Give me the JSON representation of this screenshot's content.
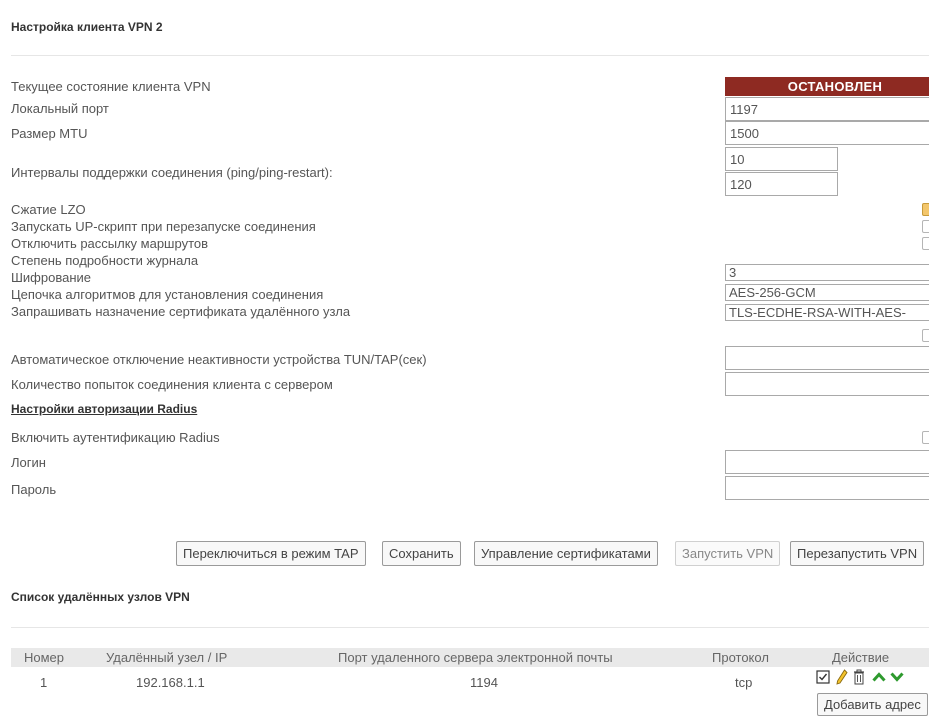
{
  "section1": {
    "title": "Настройка клиента VPN 2"
  },
  "fields": {
    "state_label": "Текущее состояние клиента VPN",
    "state_value": "ОСТАНОВЛЕН",
    "local_port_label": "Локальный порт",
    "local_port_value": "1197",
    "mtu_label": "Размер MTU",
    "mtu_value": "1500",
    "keepalive_label": "Интервалы поддержки соединения (ping/ping-restart):",
    "ping_value": "10",
    "ping_restart_value": "120",
    "lzo_label": "Сжатие LZO",
    "lzo_checked": true,
    "up_script_label": "Запускать UP-скрипт при перезапуске соединения",
    "no_routes_label": "Отключить рассылку маршрутов",
    "log_level_label": "Степень подробности журнала",
    "log_level_value": "3",
    "cipher_label": "Шифрование",
    "cipher_value": "AES-256-GCM",
    "tls_cipher_label": "Цепочка алгоритмов для установления соединения",
    "tls_cipher_value": "TLS-ECDHE-RSA-WITH-AES-",
    "remote_cert_label": "Запрашивать назначение сертификата удалённого узла",
    "inactive_label": "Автоматическое отключение неактивности устройства TUN/TAP(сек)",
    "inactive_value": "",
    "retry_label": "Количество попыток соединения клиента с сервером",
    "retry_value": ""
  },
  "radius": {
    "link": "Настройки авторизации Radius",
    "enable_label": "Включить аутентификацию Radius",
    "login_label": "Логин",
    "login_value": "",
    "password_label": "Пароль",
    "password_value": ""
  },
  "buttons": {
    "tap_mode": "Переключиться в режим TAP",
    "save": "Сохранить",
    "certs": "Управление сертификатами",
    "start": "Запустить VPN",
    "restart": "Перезапустить VPN"
  },
  "section2": {
    "title": "Список удалённых узлов VPN"
  },
  "table": {
    "headers": [
      "Номер",
      "Удалённый узел / IP",
      "Порт удаленного сервера электронной почты",
      "Протокол",
      "Действие"
    ],
    "rows": [
      {
        "num": "1",
        "host": "192.168.1.1",
        "port": "1194",
        "proto": "tcp"
      }
    ],
    "add_button": "Добавить адрес"
  },
  "colors": {
    "status_bg": "#8e2a22",
    "arrow": "#2e9a2e"
  },
  "icons": [
    "checkbox-icon",
    "pencil-icon",
    "trash-icon",
    "arrow-up-icon",
    "arrow-down-icon"
  ]
}
